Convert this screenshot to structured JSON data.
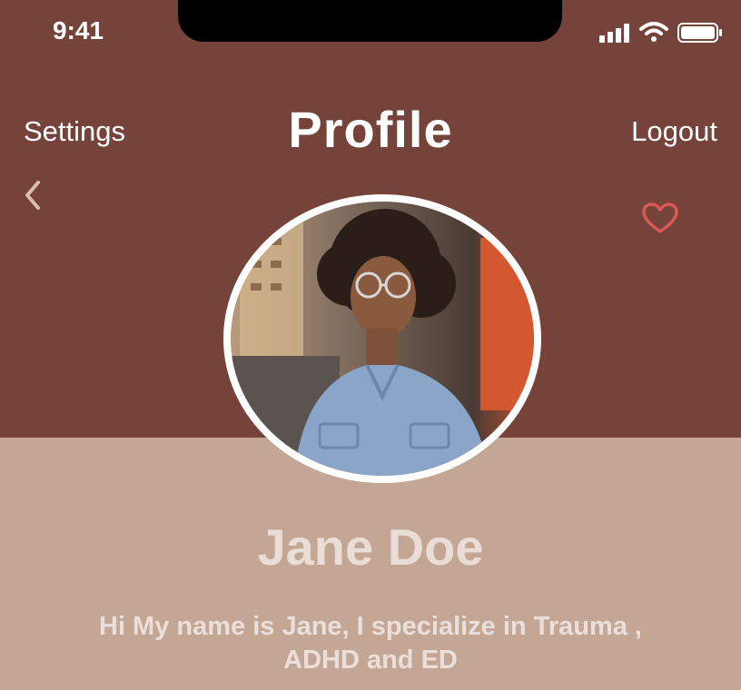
{
  "status_bar": {
    "time": "9:41"
  },
  "header": {
    "left_label": "Settings",
    "title": "Profile",
    "right_label": "Logout"
  },
  "profile": {
    "name": "Jane Doe",
    "bio": "Hi My name is Jane, I specialize in Trauma , ADHD and ED"
  },
  "icons": {
    "back": "chevron-left-icon",
    "favorite": "heart-icon",
    "signal": "signal-icon",
    "wifi": "wifi-icon",
    "battery": "battery-icon"
  },
  "colors": {
    "header_bg": "#76433b",
    "body_bg": "#c4a695",
    "heart": "#d85a52"
  }
}
